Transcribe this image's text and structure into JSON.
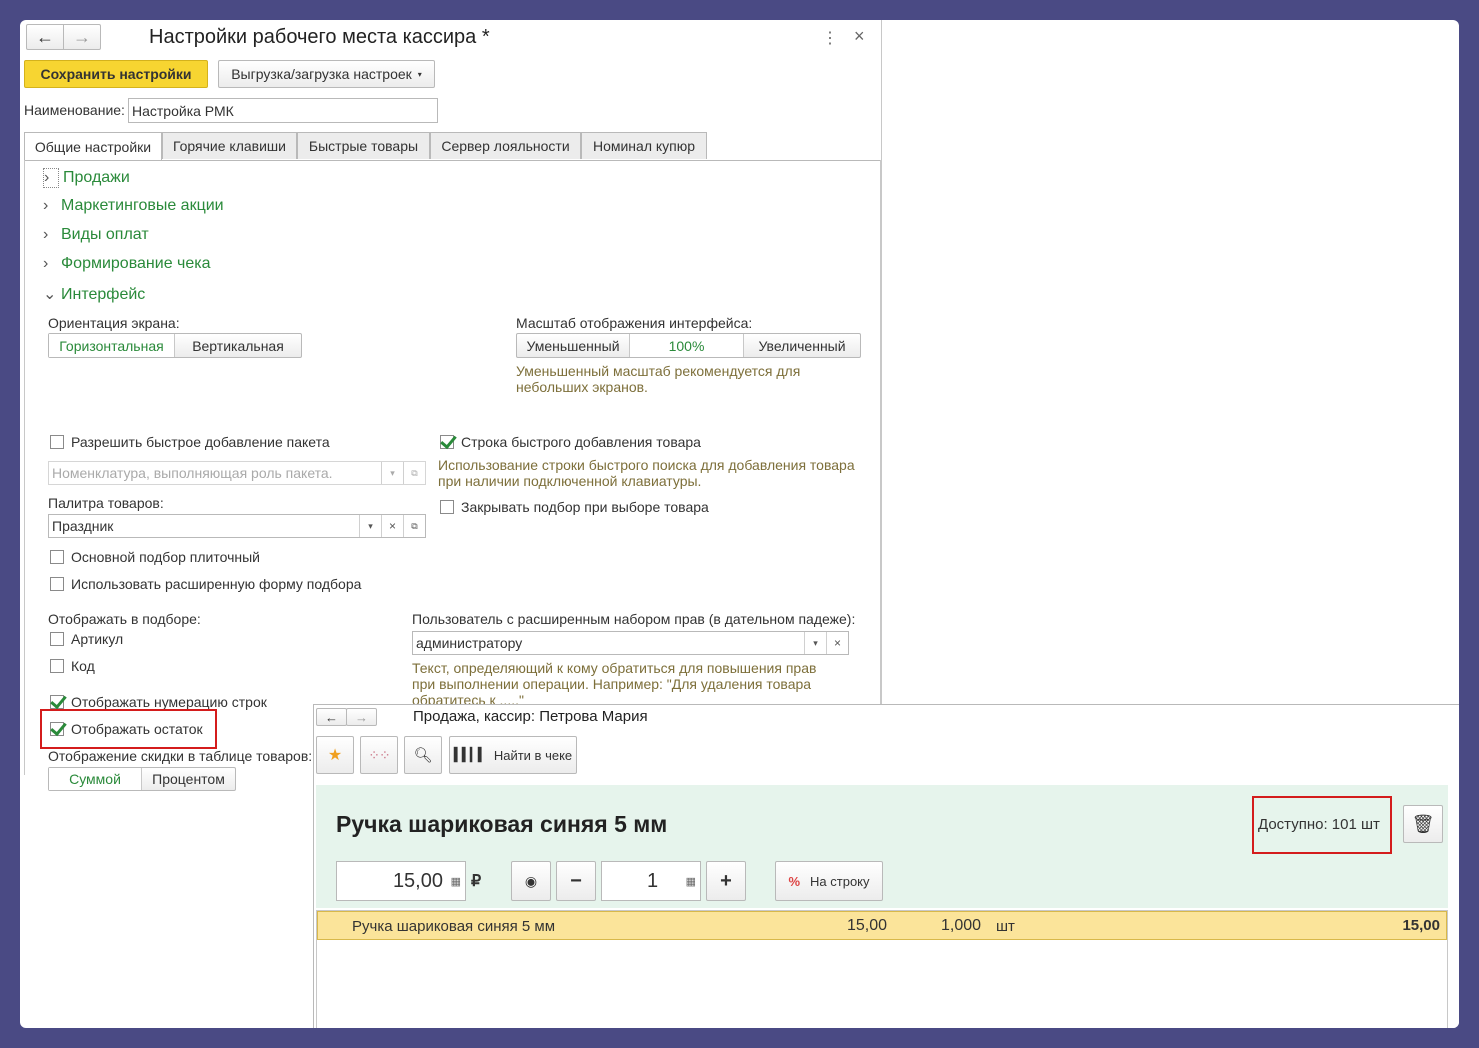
{
  "settings": {
    "title": "Настройки рабочего места кассира *",
    "nav_back": "←",
    "nav_forward": "→",
    "more": "⋮",
    "close": "×",
    "save_btn": "Сохранить настройки",
    "export_btn": "Выгрузка/загрузка настроек",
    "name_label": "Наименование:",
    "name_value": "Настройка РМК",
    "tabs": [
      "Общие настройки",
      "Горячие клавиши",
      "Быстрые товары",
      "Сервер лояльности",
      "Номинал купюр"
    ],
    "sections": [
      "Продажи",
      "Маркетинговые акции",
      "Виды оплат",
      "Формирование чека",
      "Интерфейс"
    ],
    "orientation_label": "Ориентация экрана:",
    "orientation_options": [
      "Горизонтальная",
      "Вертикальная"
    ],
    "scale_label": "Масштаб отображения интерфейса:",
    "scale_options": [
      "Уменьшенный",
      "100%",
      "Увеличенный"
    ],
    "scale_hint": "Уменьшенный масштаб рекомендуется для небольших экранов.",
    "allow_package": "Разрешить быстрое добавление пакета",
    "package_placeholder": "Номенклатура, выполняющая роль пакета.",
    "palette_label": "Палитра товаров:",
    "palette_value": "Праздник",
    "quick_add_row": "Строка быстрого добавления товара",
    "quick_add_hint": "Использование строки быстрого поиска для добавления товара при наличии подключенной клавиатуры.",
    "close_selection": "Закрывать подбор при выборе товара",
    "tile_selection": "Основной подбор плиточный",
    "extended_form": "Использовать расширенную форму подбора",
    "display_in_selection": "Отображать в подборе:",
    "article": "Артикул",
    "code": "Код",
    "user_rights_label": "Пользователь с расширенным набором прав (в дательном падеже):",
    "user_rights_value": "администратору",
    "user_rights_hint": "Текст, определяющий к кому обратиться для повышения прав при выполнении операции. Например: \"Для удаления товара обратитесь к .....\"",
    "row_numbering": "Отображать нумерацию строк",
    "show_stock": "Отображать остаток",
    "discount_display_label": "Отображение скидки в таблице товаров:",
    "discount_options": [
      "Суммой",
      "Процентом"
    ]
  },
  "sale": {
    "title": "Продажа, кассир: Петрова Мария",
    "find_in_receipt": "Найти в чеке",
    "product_name": "Ручка шариковая синяя 5 мм",
    "available": "Доступно: 101 шт",
    "price": "15,00",
    "currency": "₽",
    "quantity": "1",
    "minus": "−",
    "plus": "+",
    "percent_icon_text": "%",
    "discount_btn": "На строку",
    "rows": [
      {
        "name": "Ручка шариковая синяя 5 мм",
        "price": "15,00",
        "qty": "1,000",
        "unit": "шт",
        "sum": "15,00"
      }
    ]
  },
  "colors": {
    "accent_green": "#2a8a3a",
    "highlight_red": "#d41c1c",
    "save_yellow": "#f7d531",
    "sale_panel": "#e6f4ec",
    "row_yellow": "#fbe49a"
  }
}
